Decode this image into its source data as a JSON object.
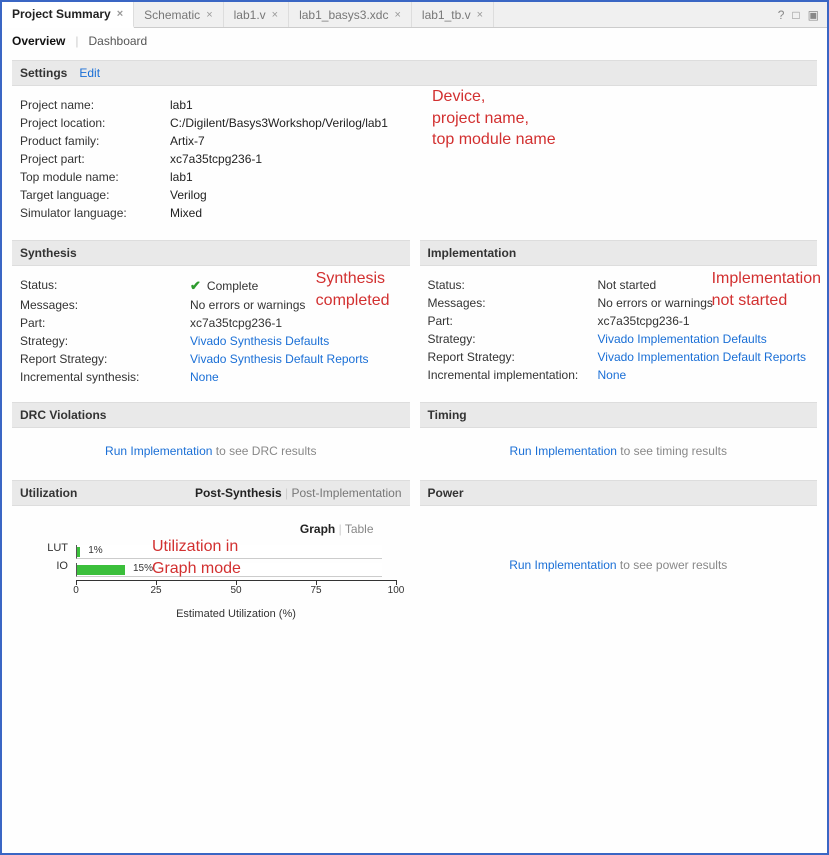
{
  "tabs": [
    {
      "label": "Project Summary",
      "closable": true,
      "active": true
    },
    {
      "label": "Schematic",
      "closable": true,
      "active": false
    },
    {
      "label": "lab1.v",
      "closable": true,
      "active": false
    },
    {
      "label": "lab1_basys3.xdc",
      "closable": true,
      "active": false
    },
    {
      "label": "lab1_tb.v",
      "closable": true,
      "active": false
    }
  ],
  "subtabs": {
    "overview": "Overview",
    "dashboard": "Dashboard"
  },
  "settings": {
    "header": "Settings",
    "edit": "Edit",
    "rows": {
      "project_name": {
        "k": "Project name:",
        "v": "lab1"
      },
      "project_location": {
        "k": "Project location:",
        "v": "C:/Digilent/Basys3Workshop/Verilog/lab1"
      },
      "product_family": {
        "k": "Product family:",
        "v": "Artix-7"
      },
      "project_part": {
        "k": "Project part:",
        "v": "xc7a35tcpg236-1",
        "link": true
      },
      "top_module": {
        "k": "Top module name:",
        "v": "lab1",
        "link": true
      },
      "target_lang": {
        "k": "Target language:",
        "v": "Verilog",
        "link": true
      },
      "sim_lang": {
        "k": "Simulator language:",
        "v": "Mixed",
        "link": true
      }
    }
  },
  "synthesis": {
    "header": "Synthesis",
    "status_k": "Status:",
    "status_v": "Complete",
    "messages_k": "Messages:",
    "messages_v": "No errors or warnings",
    "part_k": "Part:",
    "part_v": "xc7a35tcpg236-1",
    "strategy_k": "Strategy:",
    "strategy_v": "Vivado Synthesis Defaults",
    "rpt_k": "Report Strategy:",
    "rpt_v": "Vivado Synthesis Default Reports",
    "incr_k": "Incremental synthesis:",
    "incr_v": "None"
  },
  "implementation": {
    "header": "Implementation",
    "status_k": "Status:",
    "status_v": "Not started",
    "messages_k": "Messages:",
    "messages_v": "No errors or warnings",
    "part_k": "Part:",
    "part_v": "xc7a35tcpg236-1",
    "strategy_k": "Strategy:",
    "strategy_v": "Vivado Implementation Defaults",
    "rpt_k": "Report Strategy:",
    "rpt_v": "Vivado Implementation Default Reports",
    "incr_k": "Incremental implementation:",
    "incr_v": "None"
  },
  "drc": {
    "header": "DRC Violations",
    "link": "Run Implementation",
    "rest": " to see DRC results"
  },
  "timing": {
    "header": "Timing",
    "link": "Run Implementation",
    "rest": " to see timing results"
  },
  "utilization": {
    "header": "Utilization",
    "tab_post_synth": "Post-Synthesis",
    "tab_post_impl": "Post-Implementation",
    "graph": "Graph",
    "table": "Table",
    "xlabel": "Estimated Utilization (%)"
  },
  "power": {
    "header": "Power",
    "link": "Run Implementation",
    "rest": " to see power results"
  },
  "annotations": {
    "settings": "Device,\nproject name,\ntop module name",
    "synth": "Synthesis\ncompleted",
    "impl": "Implementation\nnot started",
    "util": "Utilization in\nGraph mode"
  },
  "chart_data": {
    "type": "bar",
    "orientation": "horizontal",
    "categories": [
      "LUT",
      "IO"
    ],
    "values": [
      1,
      15
    ],
    "xlabel": "Estimated Utilization (%)",
    "xlim": [
      0,
      100
    ],
    "xticks": [
      0,
      25,
      50,
      75,
      100
    ],
    "color": "#3bbf3b"
  }
}
